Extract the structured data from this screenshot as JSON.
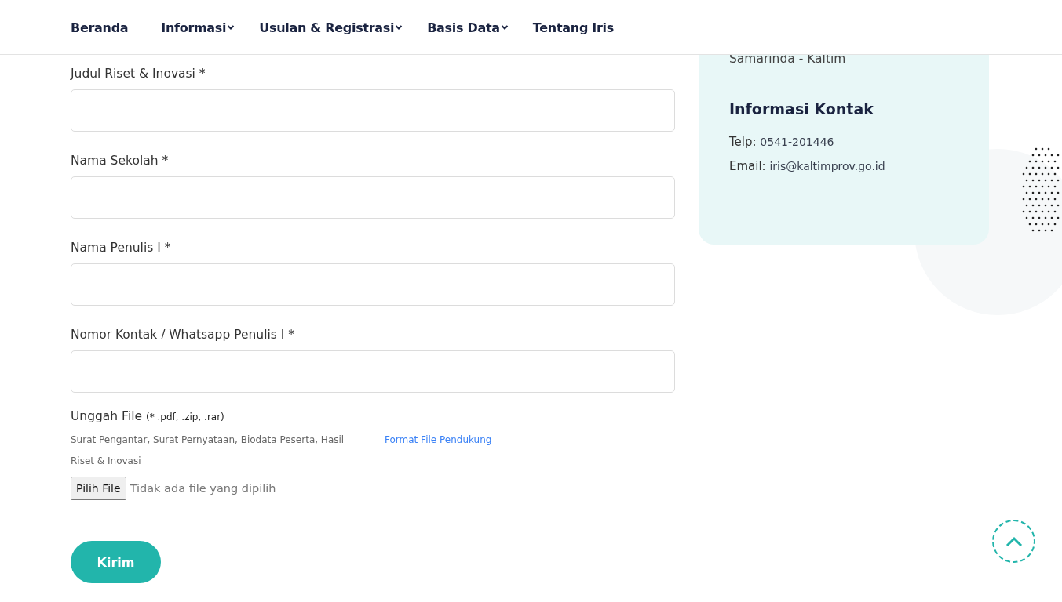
{
  "nav": {
    "items": [
      {
        "label": "Beranda",
        "dropdown": false
      },
      {
        "label": "Informasi",
        "dropdown": true
      },
      {
        "label": "Usulan & Registrasi",
        "dropdown": true
      },
      {
        "label": "Basis Data",
        "dropdown": true
      },
      {
        "label": "Tentang Iris",
        "dropdown": false
      }
    ]
  },
  "form": {
    "fields": [
      {
        "label": "Judul Riset & Inovasi *"
      },
      {
        "label": "Nama Sekolah *"
      },
      {
        "label": "Nama Penulis I *"
      },
      {
        "label": "Nomor Kontak / Whatsapp Penulis I *"
      }
    ],
    "upload": {
      "label": "Unggah File",
      "hint": "(* .pdf, .zip, .rar)",
      "description": "Surat Pengantar, Surat Pernyataan, Biodata Peserta, Hasil Riset & Inovasi",
      "link": "Format File Pendukung",
      "button": "Pilih File",
      "status": "Tidak ada file yang dipilih"
    },
    "submit": "Kirim"
  },
  "contact_card": {
    "address": "Samarinda - Kaltim",
    "heading": "Informasi Kontak",
    "lines": [
      {
        "label": "Telp:",
        "value": "0541-201446"
      },
      {
        "label": "Email:",
        "value": "iris@kaltimprov.go.id"
      }
    ]
  }
}
